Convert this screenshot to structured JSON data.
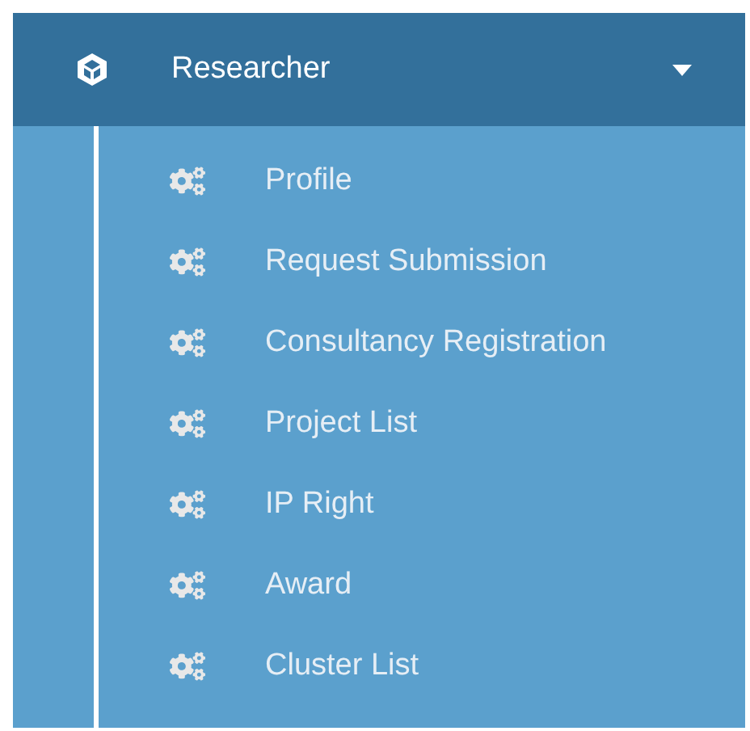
{
  "menu": {
    "title": "Researcher",
    "expanded": true,
    "items": [
      {
        "label": "Profile"
      },
      {
        "label": "Request Submission"
      },
      {
        "label": "Consultancy Registration"
      },
      {
        "label": "Project List"
      },
      {
        "label": "IP Right"
      },
      {
        "label": "Award"
      },
      {
        "label": "Cluster List"
      }
    ]
  }
}
